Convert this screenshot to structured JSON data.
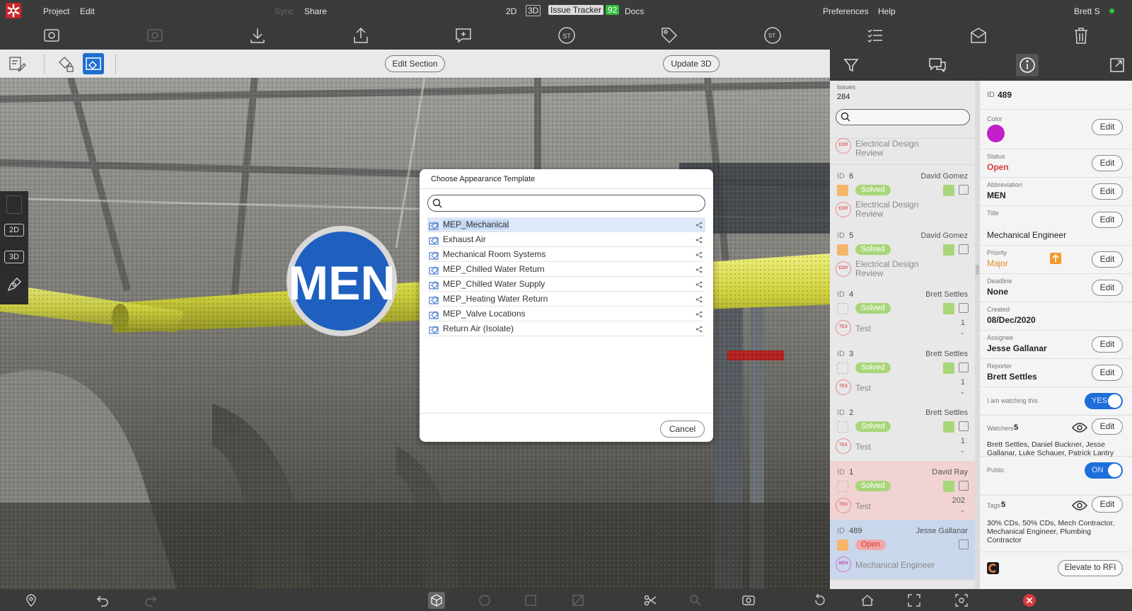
{
  "menubar": {
    "project": "Project",
    "edit": "Edit",
    "sync": "Sync",
    "share": "Share",
    "mode_2d": "2D",
    "mode_3d": "3D",
    "issue_tracker": "Issue Tracker",
    "issue_tracker_count": "92",
    "docs": "Docs",
    "preferences": "Preferences",
    "help": "Help",
    "user": "Brett S",
    "online_color": "#2fbf3a"
  },
  "subbar": {
    "edit_section": "Edit Section",
    "update_3d": "Update 3D"
  },
  "viewport": {
    "marker_label": "MEN",
    "marker_color": "#1f5fbf",
    "pipe_color": "#d9dc3f"
  },
  "sidetools": {
    "btn_2d": "2D",
    "btn_3d": "3D"
  },
  "dialog": {
    "title": "Choose Appearance Template",
    "search_placeholder": "",
    "items": [
      "MEP_Mechanical",
      "Exhaust Air",
      "Mechanical Room Systems",
      "MEP_Chilled Water Return",
      "MEP_Chilled Water Supply",
      "MEP_Heating Water Return",
      "MEP_Valve Locations",
      "Return Air (Isolate)"
    ],
    "selected_index": 0,
    "cancel": "Cancel"
  },
  "issues": {
    "label": "Issues",
    "count": "284",
    "search_placeholder": "",
    "top_partial": {
      "abbr": "EDR",
      "title_line1": "Electrical Design",
      "title_line2": "Review"
    },
    "cards": [
      {
        "id_label": "ID",
        "id": "6",
        "who": "David Gomez",
        "status": "Solved",
        "abbr": "EDR",
        "title_line1": "Electrical Design",
        "title_line2": "Review",
        "count": "",
        "prio": "up"
      },
      {
        "id_label": "ID",
        "id": "5",
        "who": "David Gomez",
        "status": "Solved",
        "abbr": "EDR",
        "title_line1": "Electrical Design",
        "title_line2": "Review",
        "count": "",
        "prio": "up"
      },
      {
        "id_label": "ID",
        "id": "4",
        "who": "Brett Settles",
        "status": "Solved",
        "abbr": "TES",
        "title_line1": "Test",
        "title_line2": "",
        "count": "1",
        "prio": "none"
      },
      {
        "id_label": "ID",
        "id": "3",
        "who": "Brett Settles",
        "status": "Solved",
        "abbr": "TES",
        "title_line1": "Test",
        "title_line2": "",
        "count": "1",
        "prio": "none"
      },
      {
        "id_label": "ID",
        "id": "2",
        "who": "Brett Settles",
        "status": "Solved",
        "abbr": "TES",
        "title_line1": "Test",
        "title_line2": "",
        "count": "1",
        "prio": "none"
      },
      {
        "id_label": "ID",
        "id": "1",
        "who": "David Ray",
        "status": "Solved",
        "abbr": "TES",
        "title_line1": "Test",
        "title_line2": "",
        "count": "202",
        "prio": "none"
      },
      {
        "id_label": "ID",
        "id": "489",
        "who": "Jesse Gallanar",
        "status": "Open",
        "abbr": "MEN",
        "title_line1": "Mechanical Engineer",
        "title_line2": "",
        "count": "",
        "prio": "up"
      }
    ]
  },
  "detail": {
    "id_label": "ID",
    "id": "489",
    "color_label": "Color",
    "color_value": "#c21fc8",
    "status_label": "Status",
    "status": "Open",
    "abbr_label": "Abbreviation",
    "abbr": "MEN",
    "title_label": "Title",
    "title": "Mechanical Engineer",
    "priority_label": "Priority",
    "priority": "Major",
    "deadline_label": "Deadline",
    "deadline": "None",
    "created_label": "Created",
    "created": "08/Dec/2020",
    "assignee_label": "Assignee",
    "assignee": "Jesse Gallanar",
    "reporter_label": "Reporter",
    "reporter": "Brett Settles",
    "watching_label": "I am watching this",
    "watching": "YES",
    "watchers_label": "Watchers",
    "watchers_count": "5",
    "watchers_line1": "Brett Settles, Daniel Buckner, Jesse",
    "watchers_line2": "Gallanar, Luke Schauer, Patrick Lantry",
    "public_label": "Public",
    "public": "ON",
    "tags_label": "Tags",
    "tags_count": "5",
    "tags_line1": "30% CDs, 50% CDs, Mech Contractor,",
    "tags_line2": "Mechanical Engineer, Plumbing",
    "tags_line3": "Contractor",
    "edit": "Edit",
    "elevate": "Elevate to RFI"
  }
}
